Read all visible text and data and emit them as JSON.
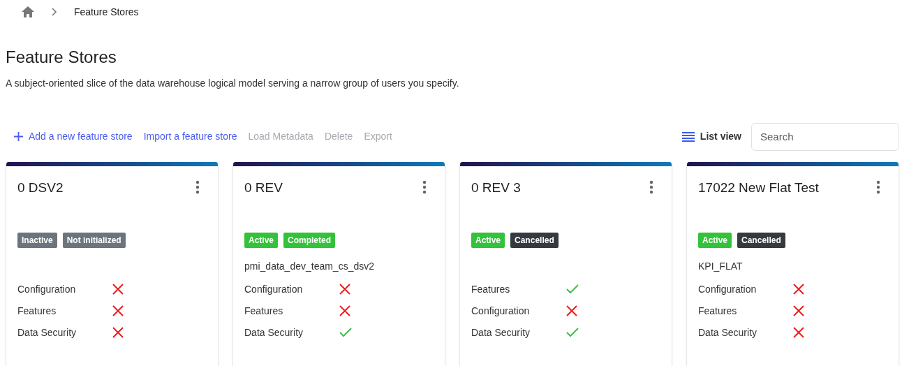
{
  "breadcrumb": {
    "current": "Feature Stores"
  },
  "page": {
    "title": "Feature Stores",
    "description": "A subject-oriented slice of the data warehouse logical model serving a narrow group of users you specify."
  },
  "toolbar": {
    "actions": [
      {
        "label": "Add a new feature store",
        "disabled": false,
        "kind": "add"
      },
      {
        "label": "Import a feature store",
        "disabled": false,
        "kind": "plain"
      },
      {
        "label": "Load Metadata",
        "disabled": true,
        "kind": "plain"
      },
      {
        "label": "Delete",
        "disabled": true,
        "kind": "plain"
      },
      {
        "label": "Export",
        "disabled": true,
        "kind": "plain"
      }
    ],
    "view_toggle": "List view",
    "search": {
      "placeholder": "Search"
    }
  },
  "cards": [
    {
      "title": "0 DSV2",
      "badges": [
        {
          "label": "Inactive",
          "color": "#6c757d"
        },
        {
          "label": "Not initialized",
          "color": "#6c757d"
        }
      ],
      "checks": [
        {
          "label": "Configuration",
          "ok": false
        },
        {
          "label": "Features",
          "ok": false
        },
        {
          "label": "Data Security",
          "ok": false
        }
      ]
    },
    {
      "title": "0 REV",
      "badges": [
        {
          "label": "Active",
          "color": "#33c23a"
        },
        {
          "label": "Completed",
          "color": "#33c23a"
        }
      ],
      "subtitle": "pmi_data_dev_team_cs_dsv2",
      "checks": [
        {
          "label": "Configuration",
          "ok": false
        },
        {
          "label": "Features",
          "ok": false
        },
        {
          "label": "Data Security",
          "ok": true
        }
      ]
    },
    {
      "title": "0 REV 3",
      "badges": [
        {
          "label": "Active",
          "color": "#33c23a"
        },
        {
          "label": "Cancelled",
          "color": "#343a40"
        }
      ],
      "checks": [
        {
          "label": "Features",
          "ok": true
        },
        {
          "label": "Configuration",
          "ok": false
        },
        {
          "label": "Data Security",
          "ok": true
        }
      ]
    },
    {
      "title": "17022 New Flat Test",
      "badges": [
        {
          "label": "Active",
          "color": "#33c23a"
        },
        {
          "label": "Cancelled",
          "color": "#343a40"
        }
      ],
      "subtitle": "KPI_FLAT",
      "checks": [
        {
          "label": "Configuration",
          "ok": false
        },
        {
          "label": "Features",
          "ok": false
        },
        {
          "label": "Data Security",
          "ok": false
        }
      ]
    }
  ]
}
